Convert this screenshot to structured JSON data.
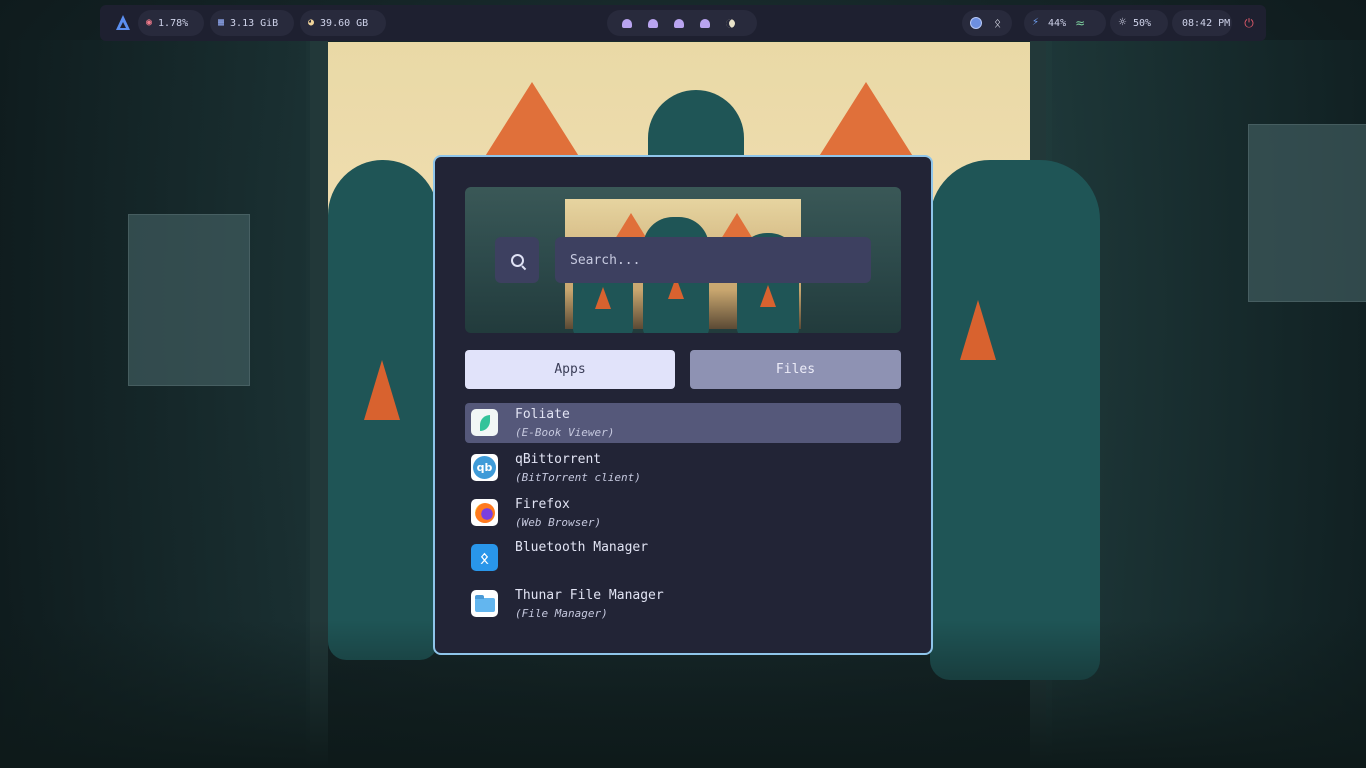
{
  "topbar": {
    "cpu": "1.78%",
    "ram": "3.13 GiB",
    "disk": "39.60 GB",
    "battery": "44%",
    "brightness": "50%",
    "clock": "08:42 PM",
    "icons": {
      "distro": "arch-logo-icon",
      "cpu": "cpu-icon",
      "ram": "memory-icon",
      "disk": "disk-icon",
      "workspaces": "ghost-icon",
      "theme": "moon-icon",
      "network": "globe-icon",
      "bluetooth": "bluetooth-icon",
      "battery": "lightning-icon",
      "wifi": "wifi-icon",
      "brightness": "sun-icon",
      "power": "power-icon"
    },
    "colors": {
      "bar_bg": "#1e2030",
      "pill_bg": "#282a3c",
      "workspace": "#b9a4f0",
      "power": "#e05a6a",
      "accent": "#5c8ff0"
    }
  },
  "launcher": {
    "search": {
      "placeholder": "Search...",
      "value": ""
    },
    "tabs": {
      "apps": "Apps",
      "files": "Files"
    },
    "active_tab": "Apps",
    "apps": [
      {
        "name": "Foliate",
        "description": "(E-Book Viewer)",
        "icon": "foliate-icon",
        "selected": true
      },
      {
        "name": "qBittorrent",
        "description": "(BitTorrent client)",
        "icon": "qbittorrent-icon",
        "selected": false
      },
      {
        "name": "Firefox",
        "description": "(Web Browser)",
        "icon": "firefox-icon",
        "selected": false
      },
      {
        "name": "Bluetooth Manager",
        "description": "",
        "icon": "bluetooth-manager-icon",
        "selected": false
      },
      {
        "name": "Thunar File Manager",
        "description": "(File Manager)",
        "icon": "folder-icon",
        "selected": false
      }
    ],
    "colors": {
      "border": "#8fc5ea",
      "bg": "#222436",
      "selected": "#55587a",
      "tab_active": "#e1e3fa",
      "tab_inactive": "#8e92b3"
    }
  }
}
